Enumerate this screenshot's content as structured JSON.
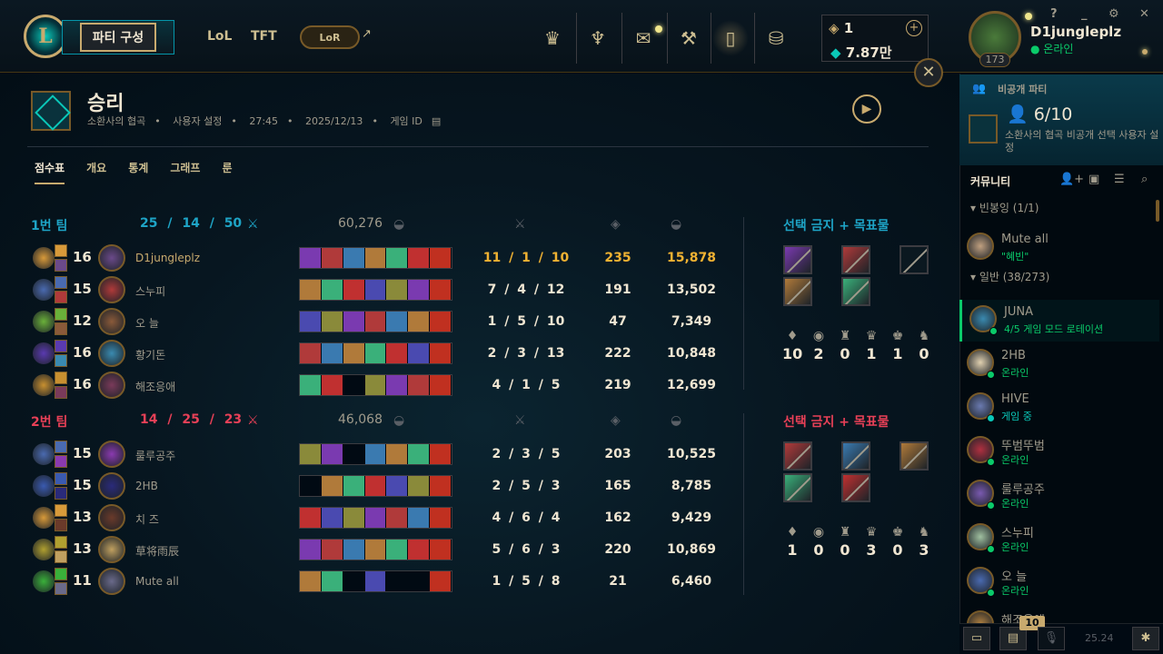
{
  "topbar": {
    "party_button": "파티 구성",
    "nav_lol": "LoL",
    "nav_tft": "TFT",
    "nav_lor": "LoR",
    "currency_rp": "1",
    "currency_be": "7.87만",
    "username": "D1jungleplz",
    "status": "온라인",
    "level": "173",
    "help": "?",
    "minimize": "_",
    "settings": "⚙",
    "close": "✕",
    "panel_close": "✕"
  },
  "header": {
    "title": "승리",
    "map": "소환사의 협곡",
    "mode": "사용자 설정",
    "duration": "27:45",
    "date": "2025/12/13",
    "game_id_label": "게임 ID"
  },
  "tabs": [
    "점수표",
    "개요",
    "통계",
    "그래프",
    "룬"
  ],
  "teams": [
    {
      "name": "1번 팀",
      "kda": "25 / 14 / 50",
      "gold": "60,276",
      "color": "#1ea4c6",
      "ban_title": "선택 금지 + 목표물",
      "objectives": [
        "10",
        "2",
        "0",
        "1",
        "1",
        "0"
      ],
      "players": [
        {
          "level": "16",
          "name": "D1jungleplz",
          "kda": "11 / 1 / 10",
          "cs": "235",
          "gold": "15,878",
          "me": true
        },
        {
          "level": "15",
          "name": "스누피",
          "kda": "7 / 4 / 12",
          "cs": "191",
          "gold": "13,502"
        },
        {
          "level": "12",
          "name": "오 늘",
          "kda": "1 / 5 / 10",
          "cs": "47",
          "gold": "7,349"
        },
        {
          "level": "16",
          "name": "황기돈",
          "kda": "2 / 3 / 13",
          "cs": "222",
          "gold": "10,848"
        },
        {
          "level": "16",
          "name": "해조응애",
          "kda": "4 / 1 / 5",
          "cs": "219",
          "gold": "12,699"
        }
      ]
    },
    {
      "name": "2번 팀",
      "kda": "14 / 25 / 23",
      "gold": "46,068",
      "color": "#e84057",
      "ban_title": "선택 금지 + 목표물",
      "objectives": [
        "1",
        "0",
        "0",
        "3",
        "0",
        "3"
      ],
      "players": [
        {
          "level": "15",
          "name": "룰루공주",
          "kda": "2 / 3 / 5",
          "cs": "203",
          "gold": "10,525"
        },
        {
          "level": "15",
          "name": "2HB",
          "kda": "2 / 5 / 3",
          "cs": "165",
          "gold": "8,785"
        },
        {
          "level": "13",
          "name": "치 즈",
          "kda": "4 / 6 / 4",
          "cs": "162",
          "gold": "9,429"
        },
        {
          "level": "13",
          "name": "草将雨辰",
          "kda": "5 / 6 / 3",
          "cs": "220",
          "gold": "10,869"
        },
        {
          "level": "11",
          "name": "Mute all",
          "kda": "1 / 5 / 8",
          "cs": "21",
          "gold": "6,460"
        }
      ]
    }
  ],
  "sidebar": {
    "party_title": "비공개 파티",
    "party_count": "6/10",
    "party_desc": "소환사의 협곡 비공개 선택 사용자 설정",
    "community": "커뮤니티",
    "group1": "빈봉잉 (1/1)",
    "group2": "일반 (38/273)",
    "friends": [
      {
        "name": "Mute all",
        "sub": "\"혜빈\"",
        "kind": "note"
      },
      {
        "name": "JUNA",
        "sub": "4/5 게임 모드 로테이션",
        "kind": "online",
        "selected": true
      },
      {
        "name": "2HB",
        "sub": "온라인",
        "kind": "online"
      },
      {
        "name": "HIVE",
        "sub": "게임 중",
        "kind": "ingame"
      },
      {
        "name": "뚜범뚜범",
        "sub": "온라인",
        "kind": "online"
      },
      {
        "name": "룰루공주",
        "sub": "온라인",
        "kind": "online"
      },
      {
        "name": "스누피",
        "sub": "온라인",
        "kind": "online"
      },
      {
        "name": "오 늘",
        "sub": "온라인",
        "kind": "online"
      },
      {
        "name": "해조응애",
        "sub": "",
        "kind": "online"
      }
    ],
    "badge": "10",
    "version": "25.24"
  },
  "colors": {
    "gold": "#c8aa6e",
    "accent": "#0ac8b9",
    "blue_team": "#1ea4c6",
    "red_team": "#e84057",
    "highlight": "#f0b232"
  }
}
